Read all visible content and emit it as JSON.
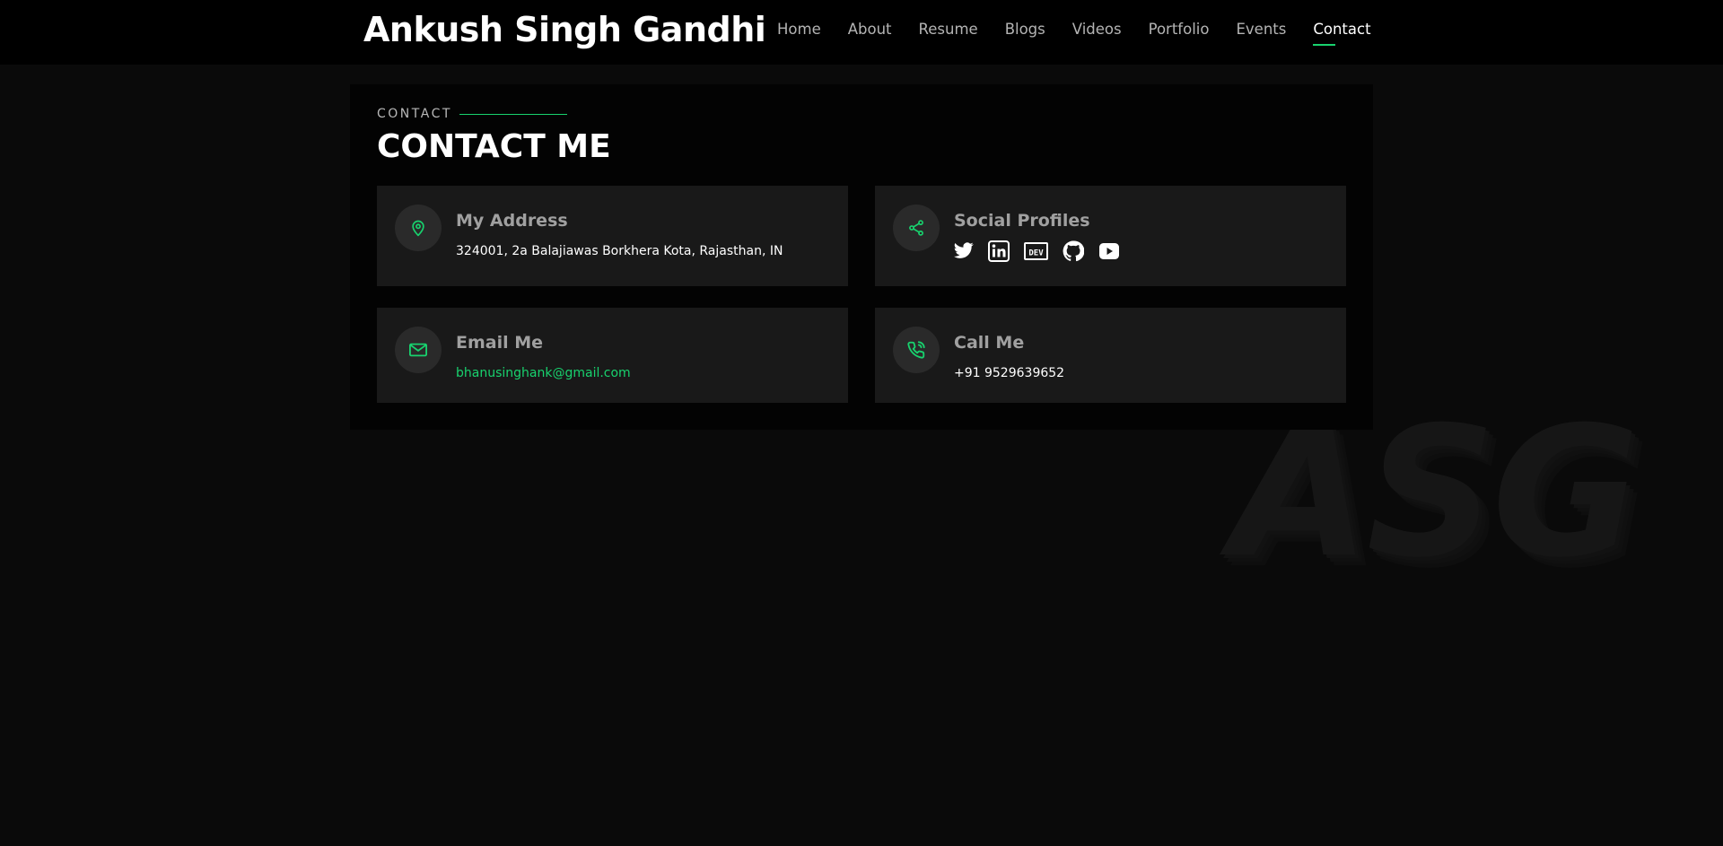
{
  "header": {
    "logo": "Ankush Singh Gandhi",
    "nav": [
      "Home",
      "About",
      "Resume",
      "Blogs",
      "Videos",
      "Portfolio",
      "Events",
      "Contact"
    ],
    "active_nav": "Contact"
  },
  "section": {
    "eyebrow": "CONTACT",
    "title": "CONTACT ME"
  },
  "cards": {
    "address": {
      "icon": "map-pin-icon",
      "title": "My Address",
      "text": "324001, 2a Balajiawas Borkhera Kota, Rajasthan, IN"
    },
    "social": {
      "icon": "share-icon",
      "title": "Social Profiles",
      "links": [
        "twitter-icon",
        "linkedin-icon",
        "dev-icon",
        "github-icon",
        "youtube-icon"
      ]
    },
    "email": {
      "icon": "envelope-icon",
      "title": "Email Me",
      "text": "bhanusinghank@gmail.com"
    },
    "call": {
      "icon": "phone-icon",
      "title": "Call Me",
      "text": "+91 9529639652"
    }
  },
  "watermark": "ASG",
  "colors": {
    "accent": "#18d26e",
    "background": "#0a0a0a",
    "card": "#191919"
  }
}
